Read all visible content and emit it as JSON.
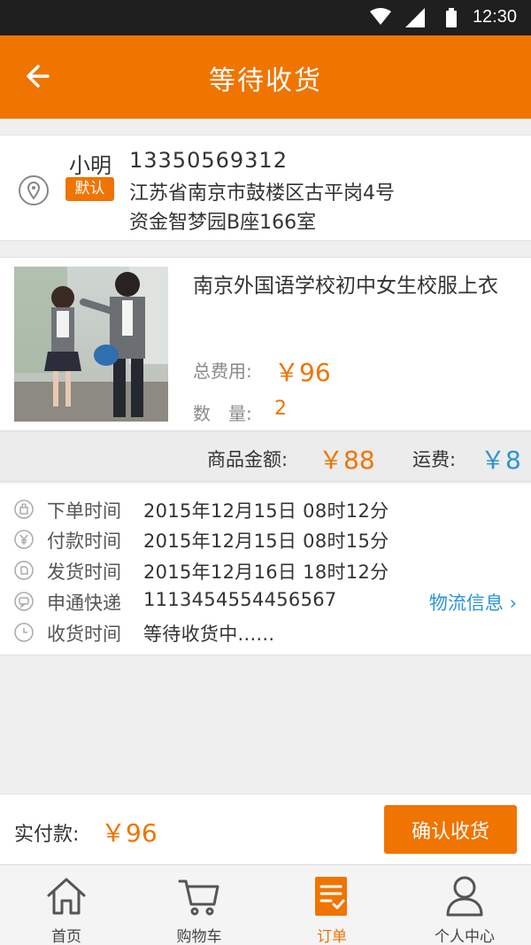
{
  "status_bar": {
    "time": "12:30"
  },
  "header": {
    "title": "等待收货"
  },
  "address": {
    "name": "小明",
    "phone": "13350569312",
    "default_badge": "默认",
    "line1": "江苏省南京市鼓楼区古平岗4号",
    "line2": "资金智梦园B座166室"
  },
  "product": {
    "name": "南京外国语学校初中女生校服上衣",
    "fee_label": "总费用:",
    "fee_value": "￥96",
    "qty_label": "数　量:",
    "qty_value": "2"
  },
  "amounts": {
    "goods_label": "商品金额:",
    "goods_value": "￥88",
    "shipping_label": "运费:",
    "shipping_value": "￥8"
  },
  "timeline": {
    "order_time_label": "下单时间",
    "order_time": "2015年12月15日 08时12分",
    "pay_time_label": "付款时间",
    "pay_time": "2015年12月15日 08时15分",
    "ship_time_label": "发货时间",
    "ship_time": "2015年12月16日 18时12分",
    "courier_label": "申通快递",
    "tracking_number": "1113454554456567",
    "logistics_link": "物流信息 ›",
    "receive_time_label": "收货时间",
    "receive_status": "等待收货中......"
  },
  "payment": {
    "paid_label": "实付款:",
    "paid_value": "￥96",
    "confirm_button": "确认收货"
  },
  "tabs": {
    "home": "首页",
    "cart": "购物车",
    "orders": "订单",
    "profile": "个人中心"
  },
  "colors": {
    "accent": "#f07400",
    "link": "#2a95d8",
    "status_bar": "#1f1f1f"
  },
  "icons": {
    "back": "arrow-left-icon",
    "location": "location-pin-icon",
    "order_time": "bag-icon",
    "pay_time": "yen-icon",
    "ship_time": "ship-icon",
    "courier": "chat-icon",
    "receive_time": "clock-icon"
  }
}
